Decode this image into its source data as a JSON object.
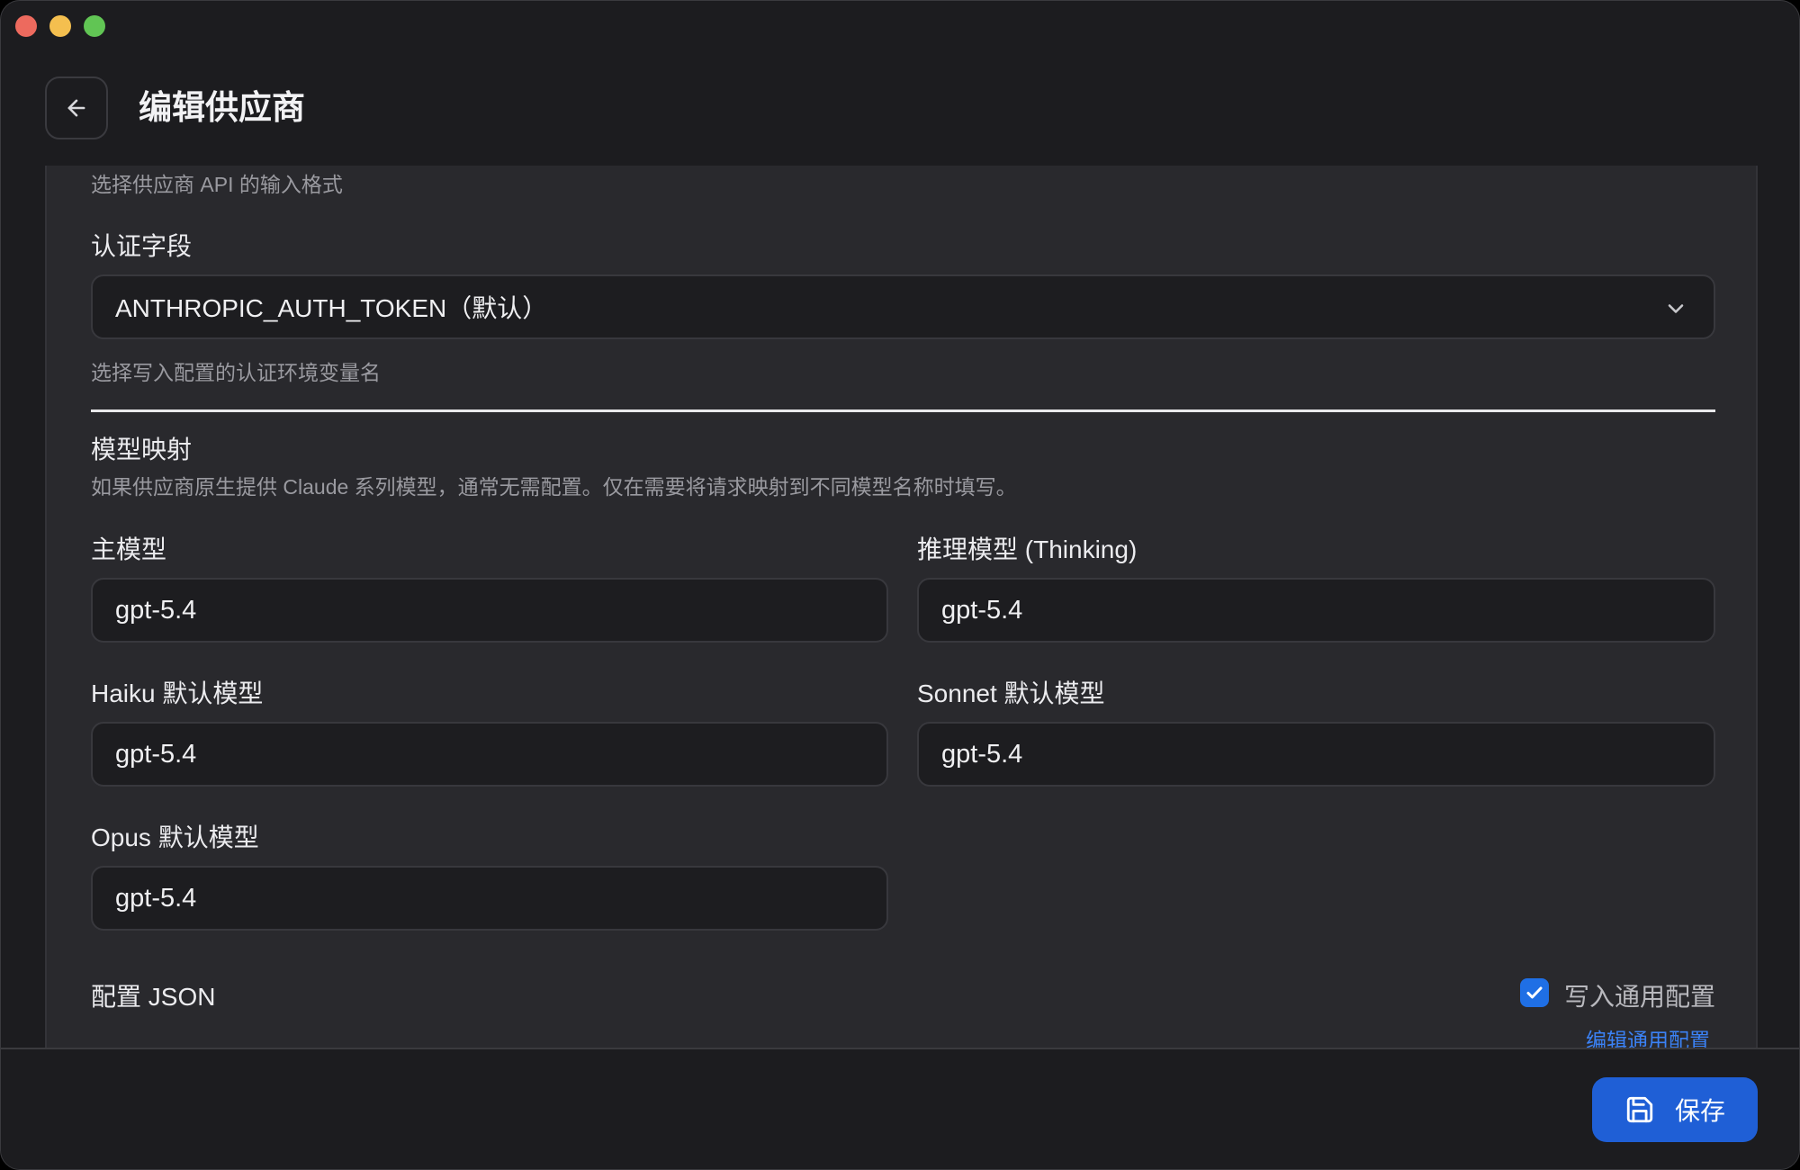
{
  "header": {
    "title": "编辑供应商"
  },
  "api_format": {
    "hint": "选择供应商 API 的输入格式"
  },
  "auth_field": {
    "label": "认证字段",
    "selected": "ANTHROPIC_AUTH_TOKEN（默认）",
    "hint": "选择写入配置的认证环境变量名"
  },
  "model_mapping": {
    "title": "模型映射",
    "description": "如果供应商原生提供 Claude 系列模型，通常无需配置。仅在需要将请求映射到不同模型名称时填写。",
    "main_model": {
      "label": "主模型",
      "value": "gpt-5.4"
    },
    "thinking_model": {
      "label": "推理模型 (Thinking)",
      "value": "gpt-5.4"
    },
    "haiku_model": {
      "label": "Haiku 默认模型",
      "value": "gpt-5.4"
    },
    "sonnet_model": {
      "label": "Sonnet 默认模型",
      "value": "gpt-5.4"
    },
    "opus_model": {
      "label": "Opus 默认模型",
      "value": "gpt-5.4"
    }
  },
  "config_json": {
    "label": "配置 JSON",
    "write_common_label": "写入通用配置",
    "write_common_checked": true,
    "edit_common_link": "编辑通用配置"
  },
  "footer": {
    "save_label": "保存"
  },
  "colors": {
    "accent": "#1f5fd6",
    "checkbox": "#1f6fe5",
    "link": "#3b82f6"
  },
  "icons": {
    "back": "arrow-left-icon",
    "select": "chevron-down-icon",
    "checkbox": "check-icon",
    "save": "floppy-disk-icon"
  }
}
